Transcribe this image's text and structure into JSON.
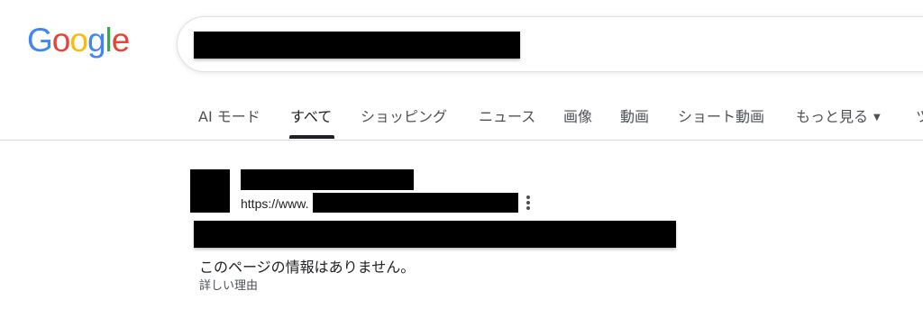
{
  "logo": {
    "letters": [
      {
        "ch": "G",
        "color": "#4285F4"
      },
      {
        "ch": "o",
        "color": "#EA4335"
      },
      {
        "ch": "o",
        "color": "#FBBC05"
      },
      {
        "ch": "g",
        "color": "#4285F4"
      },
      {
        "ch": "l",
        "color": "#34A853"
      },
      {
        "ch": "e",
        "color": "#EA4335"
      }
    ]
  },
  "search": {
    "query_redacted": true
  },
  "tabs": [
    {
      "label": "AI モード"
    },
    {
      "label": "すべて",
      "active": true
    },
    {
      "label": "ショッピング"
    },
    {
      "label": "ニュース"
    },
    {
      "label": "画像"
    },
    {
      "label": "動画"
    },
    {
      "label": "ショート動画"
    },
    {
      "label": "もっと見る"
    },
    {
      "label": "ツ"
    }
  ],
  "result": {
    "url_prefix": "https://www.",
    "snippet": "このページの情報はありません。",
    "learn_more": "詳しい理由"
  },
  "icons": {
    "more_caret": "caret-down-icon",
    "result_menu": "kebab-menu-icon"
  }
}
